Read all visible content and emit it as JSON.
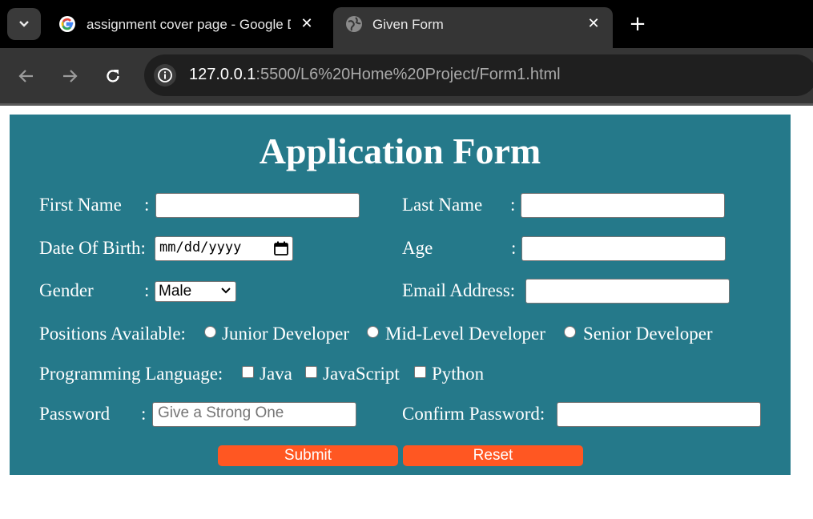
{
  "browser": {
    "tabs": [
      {
        "title": "assignment cover page - Google Docs",
        "favicon": "google-g-icon"
      },
      {
        "title": "Given Form",
        "favicon": "globe-icon"
      }
    ],
    "url_host": "127.0.0.1",
    "url_path": ":5500/L6%20Home%20Project/Form1.html"
  },
  "form": {
    "title": "Application Form",
    "colon": ":",
    "first_name_label": "First Name",
    "last_name_label": "Last Name",
    "dob_label": "Date Of Birth:",
    "dob_placeholder": "mm/dd/yyyy",
    "age_label": "Age",
    "gender_label": "Gender",
    "gender_value": "Male",
    "email_label": "Email Address:",
    "positions_label": "Positions Available:",
    "positions": [
      "Junior Developer",
      "Mid-Level Developer",
      "Senior Developer"
    ],
    "languages_label": "Programming Language:",
    "languages": [
      "Java",
      "JavaScript",
      "Python"
    ],
    "password_label": "Password",
    "password_placeholder": "Give a Strong One",
    "confirm_password_label": "Confirm Password:",
    "submit_label": "Submit",
    "reset_label": "Reset"
  },
  "colors": {
    "panel": "#25798a",
    "button": "#ff5722"
  }
}
